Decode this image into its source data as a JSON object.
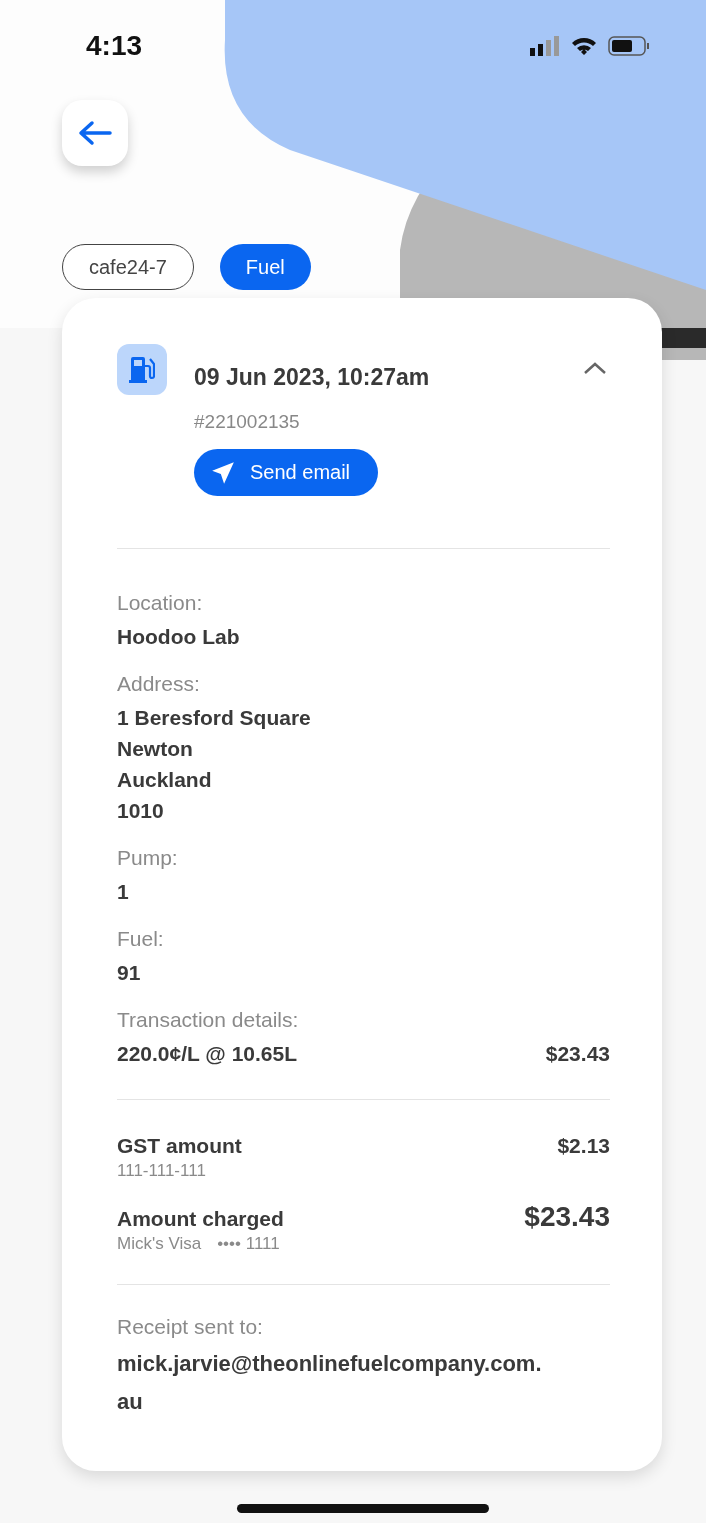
{
  "status_bar": {
    "time": "4:13"
  },
  "tags": [
    {
      "label": "cafe24-7",
      "selected": false
    },
    {
      "label": "Fuel",
      "selected": true
    }
  ],
  "receipt": {
    "expanded": true,
    "datetime": "09 Jun 2023, 10:27am",
    "number": "#221002135",
    "send_button": "Send email",
    "details": [
      {
        "label": "Location:",
        "lines": [
          "Hoodoo Lab"
        ]
      },
      {
        "label": "Address:",
        "lines": [
          "1 Beresford Square",
          "Newton",
          "Auckland",
          "1010"
        ]
      },
      {
        "label": "Pump:",
        "lines": [
          "1"
        ]
      },
      {
        "label": "Fuel:",
        "lines": [
          "91"
        ]
      }
    ],
    "transaction": {
      "label": "Transaction details:",
      "value": "220.0¢/L @ 10.65L",
      "amount": "$23.43"
    },
    "gst": {
      "label": "GST amount",
      "sub": "111-111-111",
      "amount": "$2.13"
    },
    "charged": {
      "label": "Amount charged",
      "card_name": "Mick's Visa",
      "card_mask": "•••• 1111",
      "amount": "$23.43"
    },
    "receipt_to": {
      "label": "Receipt sent to:",
      "email": "mick.jarvie@theonlinefuelcompany.com.au"
    }
  }
}
